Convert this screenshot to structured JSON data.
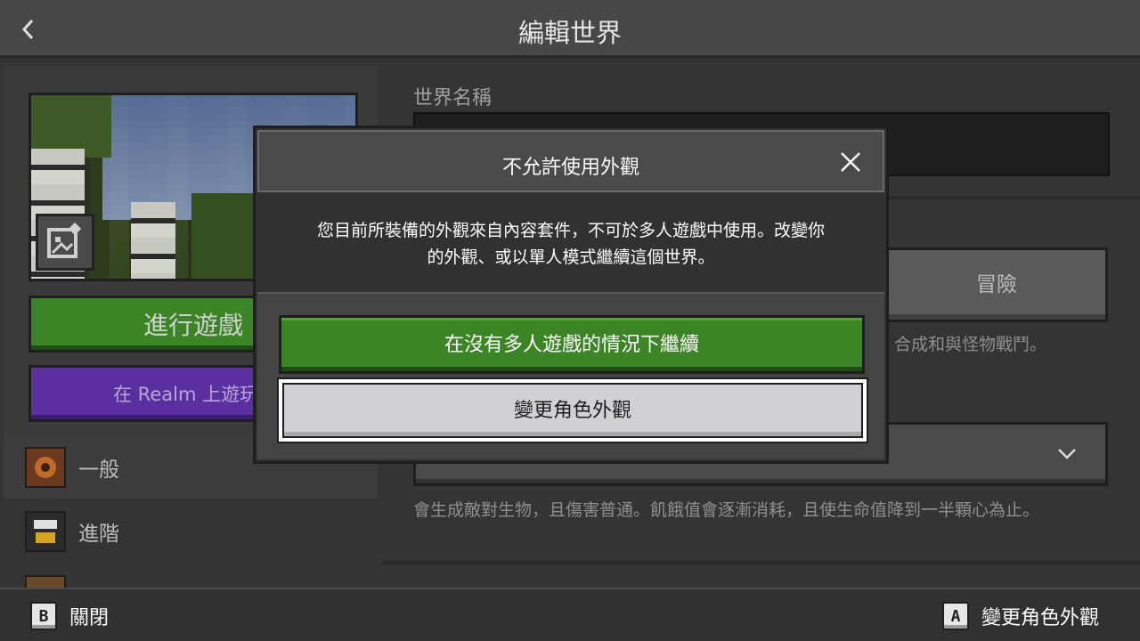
{
  "header": {
    "title": "編輯世界",
    "back_icon": "chevron-left-icon"
  },
  "left_panel": {
    "play_label": "進行遊戲",
    "realm_label": "在 Realm 上遊玩",
    "nav_items": [
      {
        "label": "一般",
        "icon": "gear-icon"
      },
      {
        "label": "進階",
        "icon": "advanced-icon"
      },
      {
        "label": "",
        "icon": "resource-icon"
      }
    ]
  },
  "right_panel": {
    "world_name_label": "世界名稱",
    "world_name_value": "",
    "game_mode_selected": "冒險",
    "game_mode_desc": "合成和與怪物戰鬥。",
    "difficulty_desc": "會生成敵對生物，且傷害普通。飢餓值會逐漸消耗，且使生命值降到一半顆心為止。"
  },
  "modal": {
    "title": "不允許使用外觀",
    "message_line1": "您目前所裝備的外觀來自內容套件，不可於多人遊戲中使用。改變你",
    "message_line2": "的外觀、或以單人模式繼續這個世界。",
    "continue_label": "在沒有多人遊戲的情況下繼續",
    "change_skin_label": "變更角色外觀",
    "colors": {
      "continue": "#3c8527",
      "change_skin": "#d0d1d4"
    }
  },
  "footer": {
    "close_key": "B",
    "close_label": "關閉",
    "confirm_key": "A",
    "confirm_label": "變更角色外觀"
  }
}
